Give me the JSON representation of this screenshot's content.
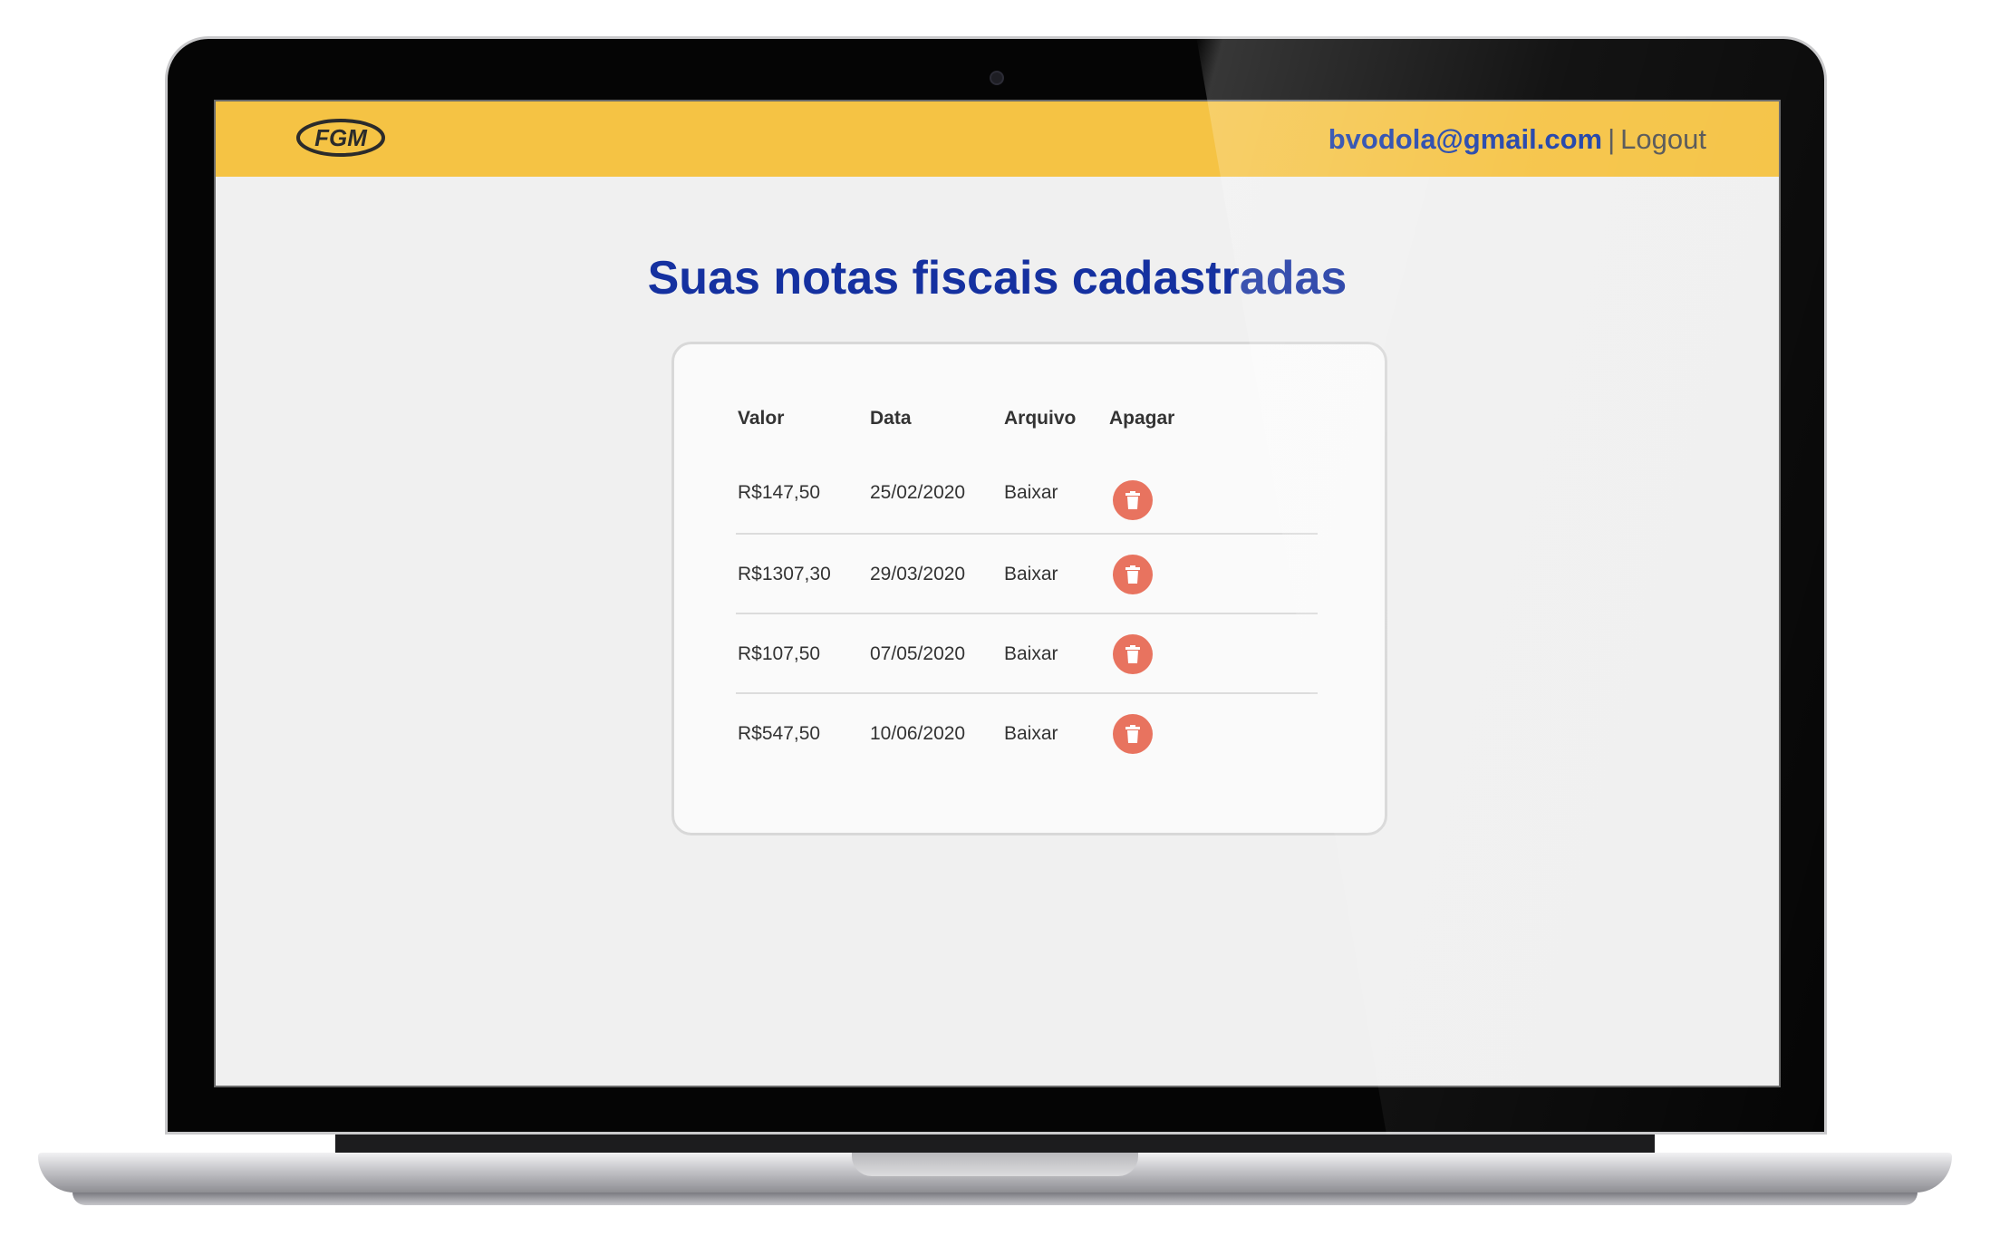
{
  "header": {
    "logo_text": "FGM",
    "user_email": "bvodola@gmail.com",
    "separator": "|",
    "logout_label": "Logout",
    "bar_color": "#f5c344"
  },
  "main": {
    "title": "Suas notas fiscais cadastradas",
    "columns": [
      "Valor",
      "Data",
      "Arquivo",
      "Apagar"
    ],
    "rows": [
      {
        "valor": "R$147,50",
        "data": "25/02/2020",
        "arquivo": "Baixar",
        "delete_icon": "trash-icon"
      },
      {
        "valor": "R$1307,30",
        "data": "29/03/2020",
        "arquivo": "Baixar",
        "delete_icon": "trash-icon"
      },
      {
        "valor": "R$107,50",
        "data": "07/05/2020",
        "arquivo": "Baixar",
        "delete_icon": "trash-icon"
      },
      {
        "valor": "R$547,50",
        "data": "10/06/2020",
        "arquivo": "Baixar",
        "delete_icon": "trash-icon"
      }
    ],
    "delete_color": "#e8735f",
    "title_color": "#1531a0"
  }
}
